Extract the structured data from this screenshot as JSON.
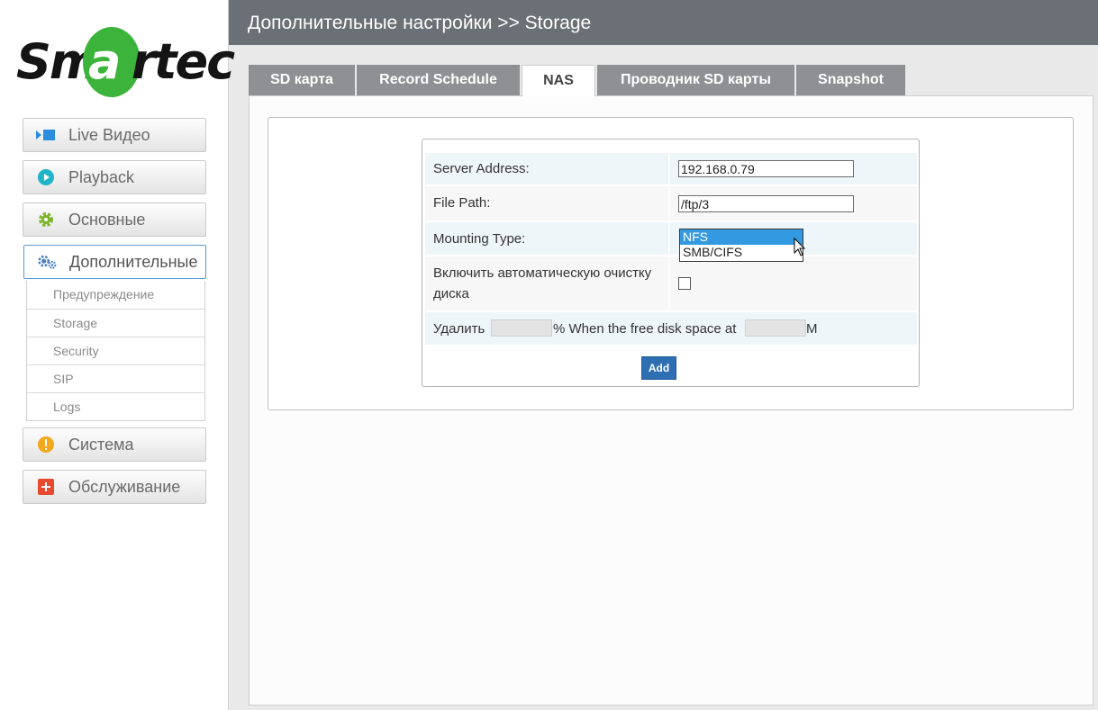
{
  "logo": {
    "left": "Sm",
    "circle": "a",
    "right": "rtec",
    "color": "#3cb43c"
  },
  "sidebar": {
    "items": [
      {
        "label": "Live Видео",
        "icon": "video-icon"
      },
      {
        "label": "Playback",
        "icon": "play-icon"
      },
      {
        "label": "Основные",
        "icon": "gear-icon"
      },
      {
        "label": "Дополнительные",
        "icon": "gears-icon",
        "active": true
      },
      {
        "label": "Система",
        "icon": "warning-icon"
      },
      {
        "label": "Обслуживание",
        "icon": "plus-icon"
      }
    ],
    "submenu": [
      "Предупреждение",
      "Storage",
      "Security",
      "SIP",
      "Logs"
    ]
  },
  "header": {
    "title": "Дополнительные настройки >> Storage"
  },
  "tabs": [
    {
      "label": "SD карта"
    },
    {
      "label": "Record Schedule"
    },
    {
      "label": "NAS",
      "active": true
    },
    {
      "label": "Проводник SD карты"
    },
    {
      "label": "Snapshot"
    }
  ],
  "form": {
    "server_address_label": "Server Address:",
    "server_address_value": "192.168.0.79",
    "file_path_label": "File Path:",
    "file_path_value": "/ftp/3",
    "mounting_type_label": "Mounting Type:",
    "mounting_options": [
      "NFS",
      "SMB/CIFS"
    ],
    "mounting_selected": "NFS",
    "auto_clean_label_line1": "Включить автоматическую очистку",
    "auto_clean_label_line2": "диска",
    "auto_clean_checked": false,
    "delete_prefix": "Удалить",
    "delete_middle": "% When the free disk space at",
    "delete_suffix": "M",
    "delete_percent_value": "",
    "free_space_value": "",
    "add_label": "Add"
  },
  "colors": {
    "header_bg": "#6b6f76",
    "tab_bg": "#8f9094",
    "accent_blue": "#2e6fb4",
    "select_highlight": "#3399e0"
  }
}
